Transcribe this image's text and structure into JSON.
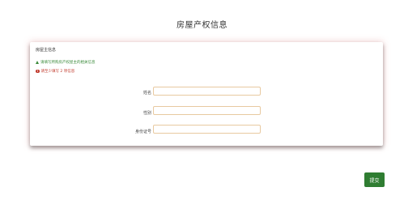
{
  "page": {
    "title": "房屋产权信息"
  },
  "card": {
    "header": "房屋主信息",
    "hint_info": "请填写所购房产权屋主的相关信息",
    "hint_error": "请至少填写 2 项信息"
  },
  "form": {
    "fields": [
      {
        "label": "姓名",
        "value": ""
      },
      {
        "label": "性别",
        "value": ""
      },
      {
        "label": "身份证号",
        "value": ""
      }
    ]
  },
  "actions": {
    "submit_label": "提交"
  },
  "colors": {
    "accent_green": "#2f7d32",
    "error_red": "#c0392b",
    "input_border": "#e8c9a0"
  },
  "icons": {
    "hint_info": "warning-triangle-icon",
    "hint_error": "error-circle-icon"
  }
}
